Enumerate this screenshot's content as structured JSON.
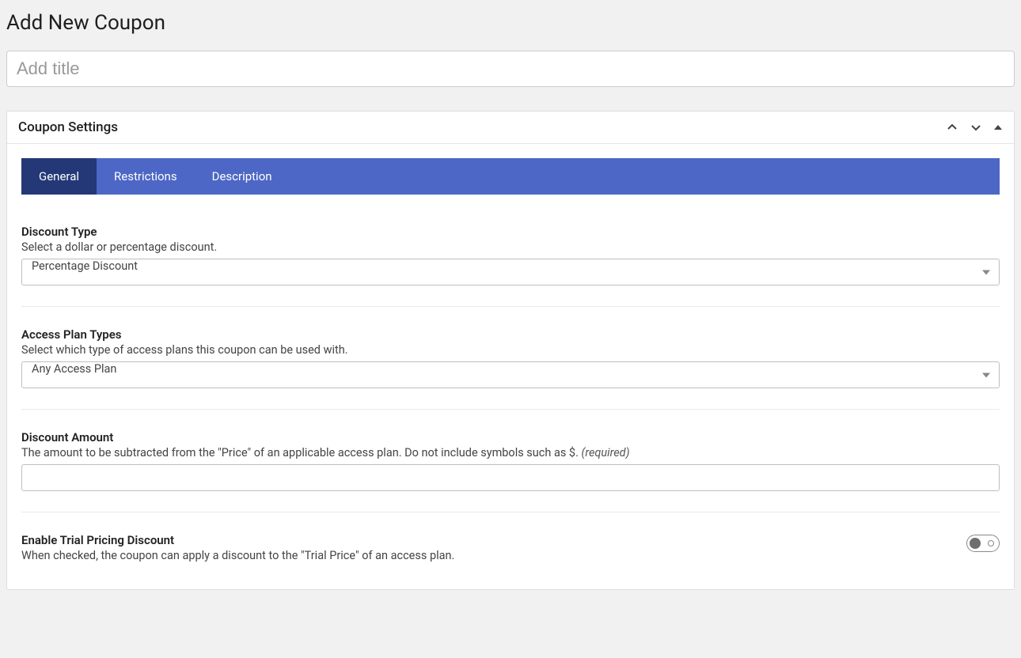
{
  "page": {
    "title": "Add New Coupon"
  },
  "titleInput": {
    "placeholder": "Add title",
    "value": ""
  },
  "panel": {
    "title": "Coupon Settings"
  },
  "tabs": {
    "general": "General",
    "restrictions": "Restrictions",
    "description": "Description"
  },
  "fields": {
    "discountType": {
      "label": "Discount Type",
      "desc": "Select a dollar or percentage discount.",
      "value": "Percentage Discount"
    },
    "accessPlanTypes": {
      "label": "Access Plan Types",
      "desc": "Select which type of access plans this coupon can be used with.",
      "value": "Any Access Plan"
    },
    "discountAmount": {
      "label": "Discount Amount",
      "desc": "The amount to be subtracted from the \"Price\" of an applicable access plan. Do not include symbols such as $. ",
      "required": "(required)",
      "value": ""
    },
    "trialPricing": {
      "label": "Enable Trial Pricing Discount",
      "desc": "When checked, the coupon can apply a discount to the \"Trial Price\" of an access plan."
    }
  }
}
